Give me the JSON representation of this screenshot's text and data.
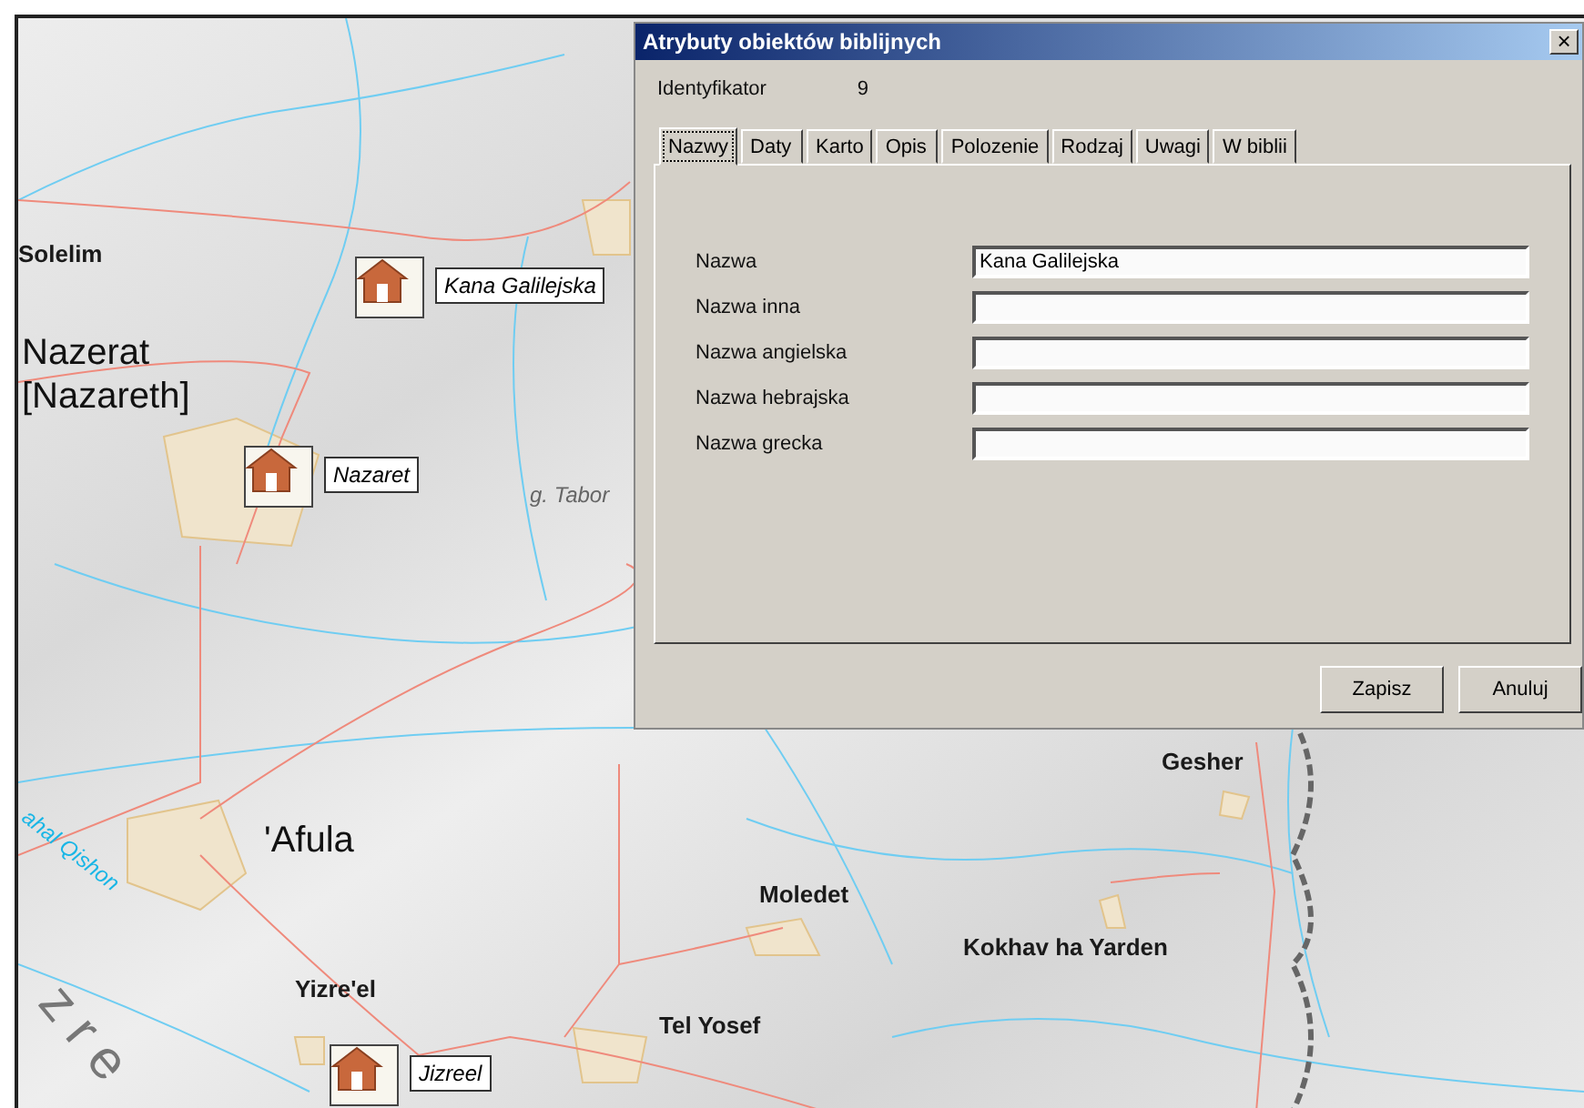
{
  "map": {
    "labels": [
      {
        "text": "Solelim",
        "kind": "town"
      },
      {
        "text": "Nazerat [Nazareth]",
        "kind": "city"
      },
      {
        "text": "g. Tabor",
        "kind": "mountain"
      },
      {
        "text": "'Afula",
        "kind": "city"
      },
      {
        "text": "ahal Qishon",
        "kind": "river"
      },
      {
        "text": "Yizre'el",
        "kind": "town"
      },
      {
        "text": "Moledet",
        "kind": "town"
      },
      {
        "text": "Tel Yosef",
        "kind": "town"
      },
      {
        "text": "Kokhav ha Yarden",
        "kind": "town"
      },
      {
        "text": "Gesher",
        "kind": "town"
      },
      {
        "text": "zre",
        "kind": "region"
      }
    ],
    "markers": [
      {
        "label": "Kana Galilejska"
      },
      {
        "label": "Nazaret"
      },
      {
        "label": "Jizreel"
      }
    ]
  },
  "dialog": {
    "title": "Atrybuty obiektów biblijnych",
    "close": "×",
    "identifier": {
      "label": "Identyfikator",
      "value": "9"
    },
    "tabs": [
      {
        "label": "Nazwy",
        "selected": true
      },
      {
        "label": "Daty",
        "selected": false
      },
      {
        "label": "Karto",
        "selected": false
      },
      {
        "label": "Opis",
        "selected": false
      },
      {
        "label": "Polozenie",
        "selected": false
      },
      {
        "label": "Rodzaj",
        "selected": false
      },
      {
        "label": "Uwagi",
        "selected": false
      },
      {
        "label": "W biblii",
        "selected": false
      }
    ],
    "fields": [
      {
        "label": "Nazwa",
        "value": "Kana Galilejska"
      },
      {
        "label": "Nazwa inna"
      },
      {
        "label": "Nazwa angielska"
      },
      {
        "label": "Nazwa hebrajska"
      },
      {
        "label": "Nazwa grecka"
      }
    ],
    "buttons": [
      "Zapisz",
      "Anuluj"
    ]
  }
}
